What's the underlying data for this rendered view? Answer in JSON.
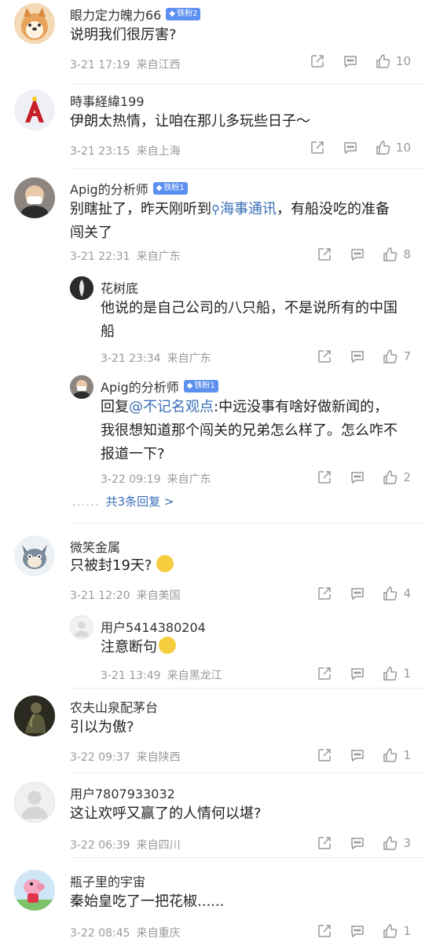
{
  "comments": [
    {
      "name": "眼力定力魄力66",
      "badge": "铁粉2",
      "text": "说明我们很厉害?",
      "date": "3-21 17:19",
      "location": "来自江西",
      "likes": "10"
    },
    {
      "name": "時事経緯199",
      "text": "伊朗太热情，让咱在那儿多玩些日子～",
      "date": "3-21 23:15",
      "location": "来自上海",
      "likes": "10"
    },
    {
      "name": "Apig的分析师",
      "badge": "铁粉1",
      "text_l1_pre": "别瞎扯了，昨天刚听到",
      "text_l1_link": "海事通讯",
      "text_l1_post": "，有船没吃的准备",
      "text_l2": "闯关了",
      "date": "3-21 22:31",
      "location": "来自广东",
      "likes": "8"
    },
    {
      "name": "微笑金属",
      "text": "只被封19天?",
      "date": "3-21 12:20",
      "location": "来自美国",
      "likes": "4"
    },
    {
      "name": "农夫山泉配茅台",
      "text": "引以为傲?",
      "date": "3-22 09:37",
      "location": "来自陕西",
      "likes": "1"
    },
    {
      "name": "用户7807933032",
      "text": "这让欢呼又赢了的人情何以堪?",
      "date": "3-22 06:39",
      "location": "来自四川",
      "likes": "3"
    },
    {
      "name": "瓶子里的宇宙",
      "text": "秦始皇吃了一把花椒......",
      "date": "3-22 08:45",
      "location": "来自重庆",
      "likes": "1"
    }
  ],
  "replies": [
    {
      "name": "花树底",
      "text_l1": "他说的是自己公司的八只船，不是说所有的中国",
      "text_l2": "船",
      "date": "3-21 23:34",
      "location": "来自广东",
      "likes": "7"
    },
    {
      "name": "Apig的分析师",
      "badge": "铁粉1",
      "text_l1_pre": "回复",
      "text_l1_mention": "@不记名观点",
      "text_l1_post": ":中远没事有啥好做新闻的，",
      "text_l2": "我很想知道那个闯关的兄弟怎么样了。怎么咋不",
      "text_l3": "报道一下?",
      "date": "3-22 09:19",
      "location": "来自广东",
      "likes": "2"
    },
    {
      "name": "用户5414380204",
      "text": "注意断句",
      "date": "3-21 13:49",
      "location": "来自黑龙江",
      "likes": "1"
    }
  ],
  "more_replies": {
    "dots": "......",
    "label": "共3条回复 >"
  },
  "colors": {
    "link": "#3a6fb9",
    "badge": "#5b8ff0",
    "meta": "#9a9a9a"
  }
}
